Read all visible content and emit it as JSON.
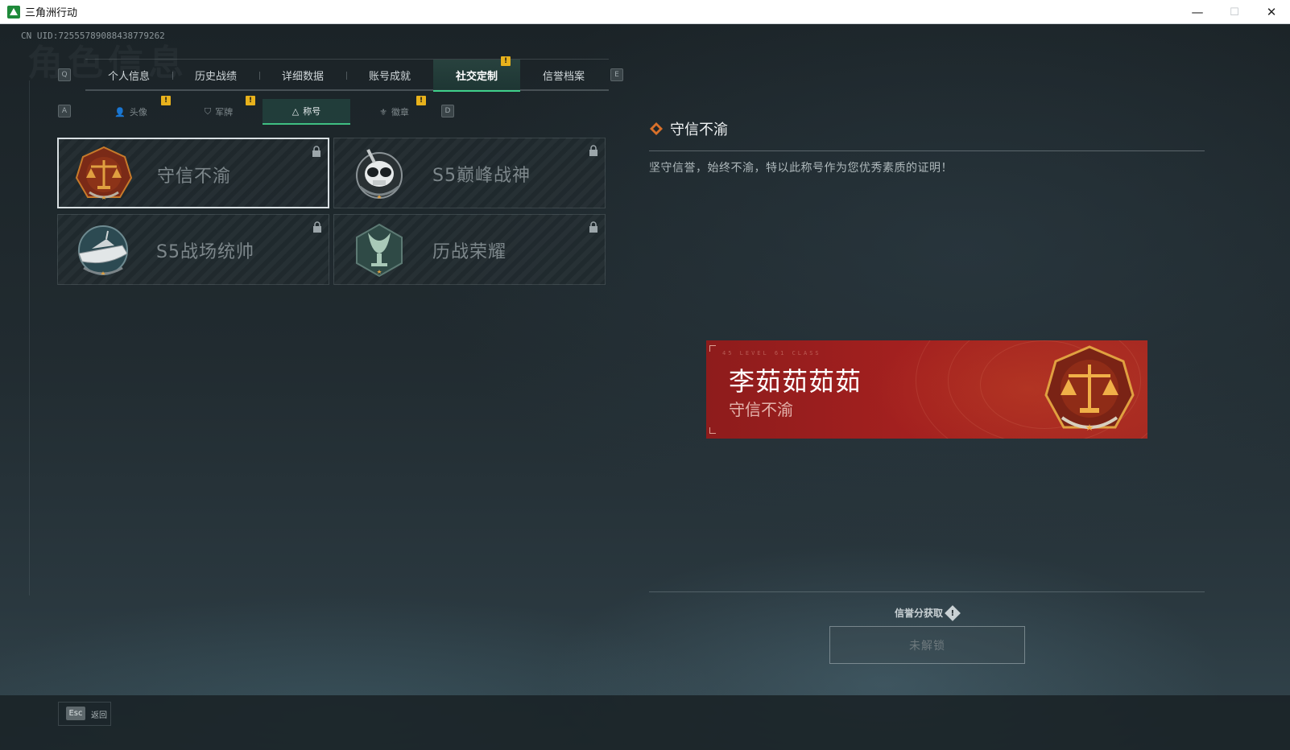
{
  "window": {
    "app_title": "三角洲行动",
    "min_glyph": "—",
    "max_glyph": "☐",
    "close_glyph": "✕"
  },
  "header": {
    "uid": "CN UID:7255578908843877926​2",
    "bg_title": "角色信息"
  },
  "keys": {
    "prev_tab": "Q",
    "next_tab": "E",
    "prev_sub": "A",
    "next_sub": "D"
  },
  "tabs": [
    {
      "label": "个人信息"
    },
    {
      "label": "历史战绩"
    },
    {
      "label": "详细数据"
    },
    {
      "label": "账号成就"
    },
    {
      "label": "社交定制",
      "active": true
    },
    {
      "label": "信誉档案"
    }
  ],
  "subtabs": [
    {
      "label": "头像",
      "icon": "person-icon"
    },
    {
      "label": "军牌",
      "icon": "dogtag-icon"
    },
    {
      "label": "称号",
      "icon": "triangle-icon",
      "active": true
    },
    {
      "label": "徽章",
      "icon": "badge-icon"
    }
  ],
  "warn_glyph": "!",
  "titles": [
    {
      "label": "守信不渝",
      "icon": "scales-emblem-icon",
      "locked": true,
      "selected": true
    },
    {
      "label": "S5巅峰战神",
      "icon": "skull-emblem-icon",
      "locked": true
    },
    {
      "label": "S5战场统帅",
      "icon": "boat-emblem-icon",
      "locked": true
    },
    {
      "label": "历战荣耀",
      "icon": "trophy-emblem-icon",
      "locked": true
    }
  ],
  "detail": {
    "title": "守信不渝",
    "description": "坚守信誉，始终不渝，特以此称号作为您优秀素质的证明！"
  },
  "nameplate": {
    "player_name": "李茹茹茹茹",
    "title": "守信不渝",
    "tiny_text": "45 LEVEL  61 CLASS"
  },
  "unlock": {
    "source_label": "信誉分获取",
    "button_label": "未解锁"
  },
  "footer": {
    "esc_label": "Esc",
    "back_label": "返回"
  },
  "colors": {
    "accent": "#3fd08a",
    "warn": "#e8b21c",
    "nameplate_red": "#a3201f",
    "emblem_gold": "#d8902c"
  }
}
